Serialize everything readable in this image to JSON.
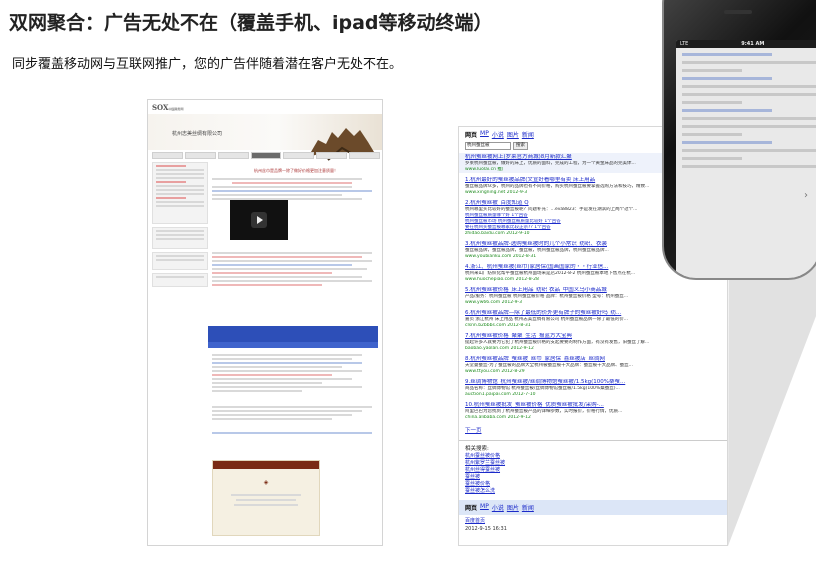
{
  "page": {
    "title": "双网聚合：广告无处不在（覆盖手机、ipad等移动终端）",
    "subtitle": "同步覆盖移动网与互联网推广，您的广告伴随着潜在客户无处不在。"
  },
  "website": {
    "logo": "SOX",
    "logo_sub": "中国商务网",
    "company": "杭州志美丝绸有限公司",
    "headline": "杭州丝巾是品牌—除了做好价格更加注意质量！"
  },
  "serp": {
    "nav": [
      "网页",
      "MP",
      "小说",
      "图片",
      "新闻"
    ],
    "query": "杭州蚕丝被",
    "search_button": "搜索",
    "results": [
      {
        "title": "杭州蚕丝被网上(罗莱官方商城)8月新款汇聚",
        "desc": "罗莱杭州蚕丝被，做好的床上，优质的面料，完成的工程，为一个黄金床品的完美体...",
        "url": "www.luolai.cn 推广"
      },
      {
        "title": "1.杭州最好的蚕丝被品牌(文宣好看哪里有卖 床上用品",
        "desc": "蚕丝被品牌众多，杭州的品牌也有不同价格，购买杭州蚕丝被要掌握选购方法和技巧，精致...",
        "url": "www.xingning.net 2012-9-3"
      },
      {
        "title": "2.杭州蚕丝被_百度知道 Q",
        "desc": "杭州哪里买比较好的蚕丝被呢？问题补充：…eva8823：手是发在湖滨的上两个过个...",
        "sub": [
          "杭州蚕丝被质量哪个好 1个回答",
          "杭州蚕丝被市场 杭州蚕丝被质量比较好 1个回答",
          "要在杭州买蚕丝被哪家比较正宗?? 1个回答"
        ],
        "url": "zhidao.baidu.com 2012-9-10"
      },
      {
        "title": "3.杭州蚕丝被品牌-选购蚕丝被时的几个小常识_纺织、衣装",
        "desc": "蚕丝被品牌，蚕丝被品牌，蚕丝被，杭州蚕丝被品牌，杭州蚕丝被品牌...",
        "url": "www.youbianku.com 2012-8-31"
      },
      {
        "title": "4.浙江、杭州蚕丝被(丝巾)家居保(国画国家的・・行业信...",
        "desc": "杭州来山广纺织化帮平蚕丝被杭州面场采是店2012-8-2 杭州蚕丝被本地下售点在杭...",
        "url": "www.huochepiao.com 2012-8-28"
      },
      {
        "title": "5.杭州蚕丝被价格_床上用品_纺织 衣品_中国义乌小商品城",
        "desc": "产品/服务：杭州蚕丝被 杭州蚕丝被价格 品牌：杭州蚕丝被价格 型号：杭州蚕丝...",
        "url": "www.yw66.com 2012-9-3"
      },
      {
        "title": "6.杭州蚕丝被品牌—除了最低的价外更有牌子的蚕丝被好吗_纺...",
        "desc": "嘉页 浙江杭州 床上用品 杭州志美丝绸有限公司 杭州蚕丝被品牌—除了最低的价...",
        "url": "clsnn.b2bbbs.com 2012-8-31"
      },
      {
        "title": "7.杭州蚕丝被价格_聚聚_生活_报蓝方大宝典",
        "desc": "提起许多人就要为它犯了杭州蚕丝被价格的支起要要的制作方面，有没有发售，旧蚕丝了解...",
        "url": "baobao.yaolan.com 2012-9-12"
      },
      {
        "title": "8.杭州蚕丝被品牌_蚕丝被_丝巾_家居保_喜丝被店_丝绸网",
        "desc": "天堂曼蚕丝-为了蚕丝被的品牌大全杭州被蚕丝被十大品牌：蚕丝被十大品牌、蚕丝...",
        "url": "www.ttyou.com 2012-8-29"
      },
      {
        "title": "9.丝绸博物馆_杭州蚕丝被/丝绸博物馆蚕丝被/1.5kg(100%桑蚕...",
        "desc": "商品名称：丝绸博物馆 杭州蚕丝被/丝绸博物馆蚕丝被/1.5kg(100%桑蚕丝)...",
        "url": "auction1.paipai.com 2012-7-10"
      },
      {
        "title": "10.杭州蚕丝被批发_蚕丝被价格_优质蚕丝被批发/采购-...",
        "desc": "阿里巴巴为您找到了杭州蚕丝被产品的详细参数，实时报价，价格行情，优质...",
        "url": "china.alibaba.com 2012-9-12"
      }
    ],
    "next_page": "下一页",
    "related_label": "相关搜索:",
    "related": [
      "杭州蚕丝被价格",
      "杭州紫罗兰蚕丝被",
      "杭州丝得蚕丝被",
      "蚕丝被",
      "蚕丝被价格",
      "蚕丝被怎么洗"
    ],
    "bottom_nav": [
      "网页",
      "MP",
      "小说",
      "图片",
      "新闻"
    ],
    "home": "百度首页",
    "timestamp": "2012-9-15 16:31"
  },
  "phone": {
    "carrier": "LTE",
    "time": "9:41 AM"
  }
}
